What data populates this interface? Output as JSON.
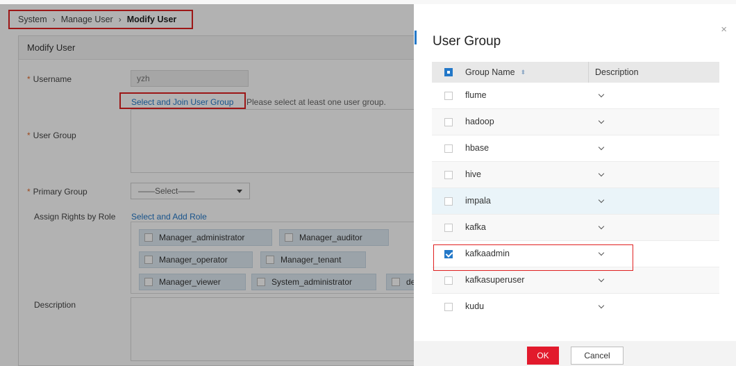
{
  "breadcrumb": {
    "item1": "System",
    "item2": "Manage User",
    "current": "Modify User",
    "sep": "›"
  },
  "form": {
    "panel_title": "Modify User",
    "required_mark": "*",
    "username_label": "Username",
    "username_value": "yzh",
    "join_group_link": "Select and Join User Group",
    "join_group_hint": "Please select at least one user group.",
    "user_group_label": "User Group",
    "primary_group_label": "Primary Group",
    "primary_group_value": "——Select——",
    "assign_rights_label": "Assign Rights by Role",
    "add_role_link": "Select and Add Role",
    "roles": [
      "Manager_administrator",
      "Manager_auditor",
      "Manager_operator",
      "Manager_tenant",
      "Manager_viewer",
      "System_administrator",
      "de"
    ],
    "description_label": "Description"
  },
  "dialog": {
    "title": "User Group",
    "close_glyph": "×",
    "columns": {
      "name": "Group Name",
      "description": "Description"
    },
    "sort_glyph": "⬍",
    "rows": [
      {
        "name": "flume",
        "checked": false
      },
      {
        "name": "hadoop",
        "checked": false
      },
      {
        "name": "hbase",
        "checked": false
      },
      {
        "name": "hive",
        "checked": false
      },
      {
        "name": "impala",
        "checked": false
      },
      {
        "name": "kafka",
        "checked": false
      },
      {
        "name": "kafkaadmin",
        "checked": true
      },
      {
        "name": "kafkasuperuser",
        "checked": false
      },
      {
        "name": "kudu",
        "checked": false
      }
    ],
    "ok_label": "OK",
    "cancel_label": "Cancel"
  },
  "colors": {
    "accent": "#2378c8",
    "ok_button": "#e21a2c",
    "highlight_box": "#e02020"
  }
}
